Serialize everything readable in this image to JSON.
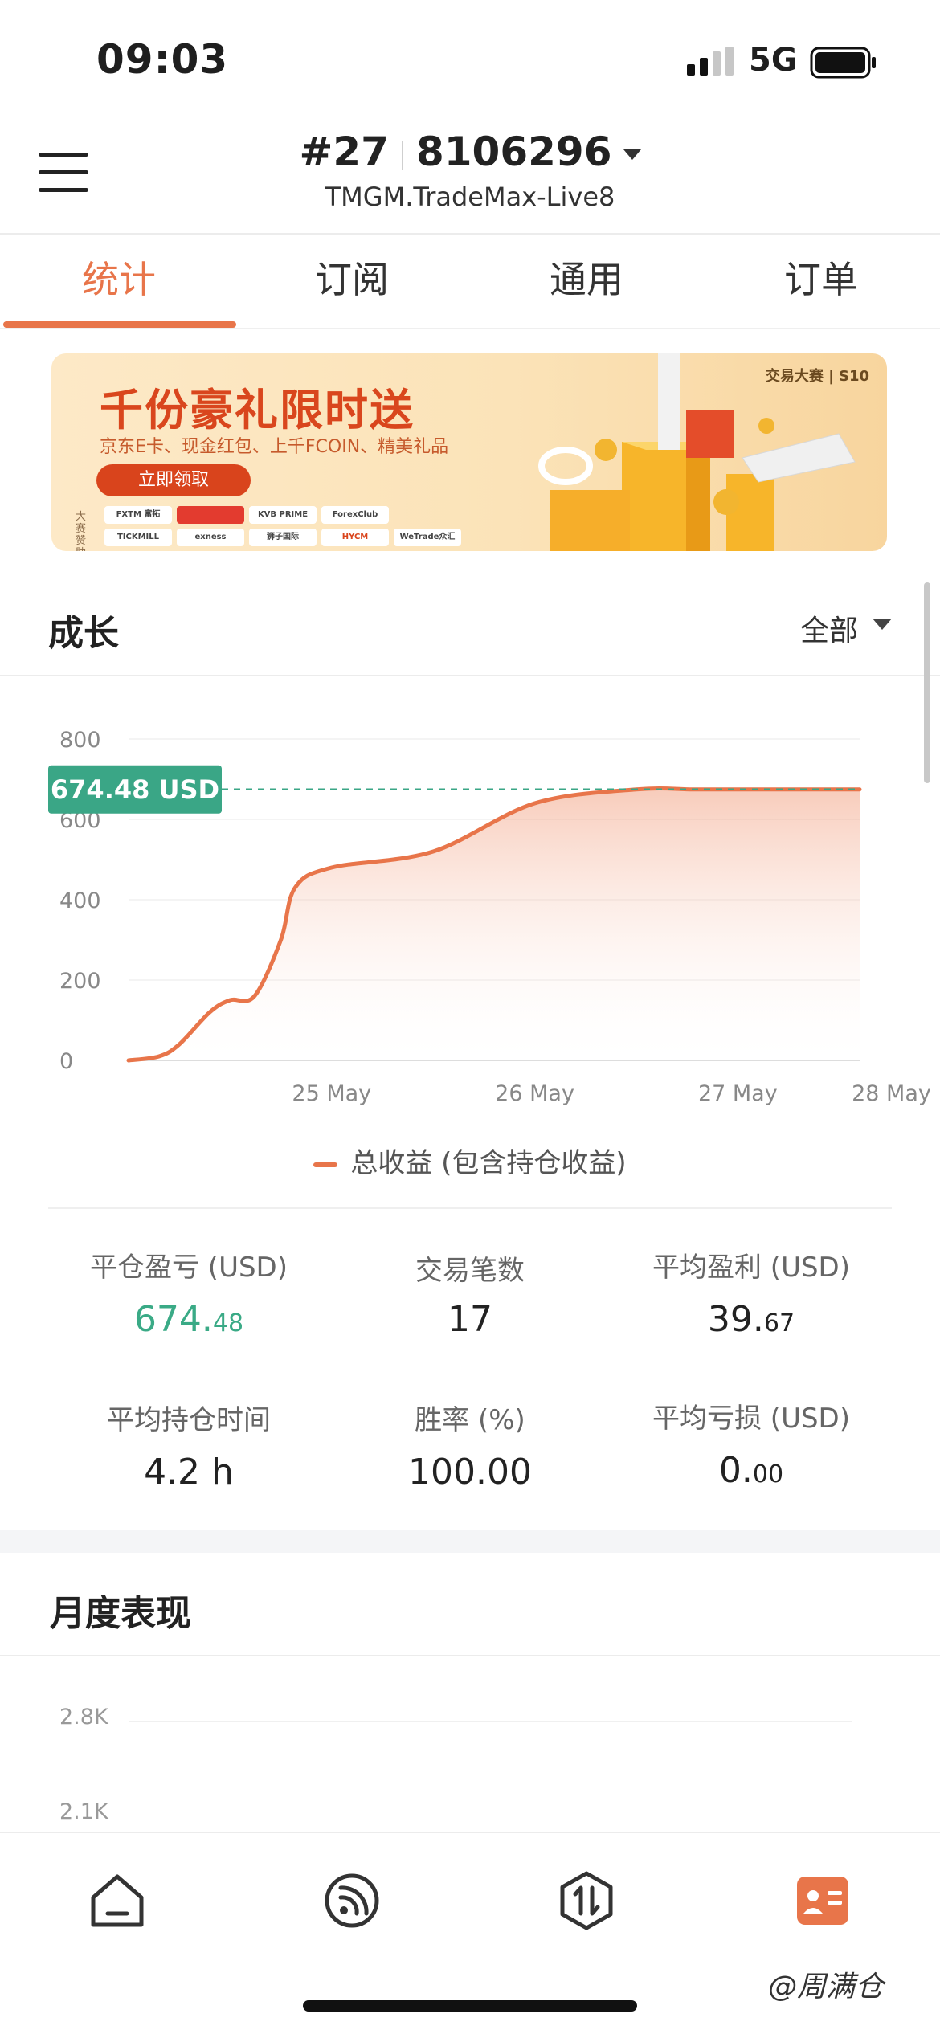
{
  "status_bar": {
    "time": "09:03",
    "network": "5G"
  },
  "header": {
    "account_rank": "#27",
    "account_id": "8106296",
    "server": "TMGM.TradeMax-Live8"
  },
  "tabs": [
    {
      "label": "统计",
      "active": true
    },
    {
      "label": "订阅",
      "active": false
    },
    {
      "label": "通用",
      "active": false
    },
    {
      "label": "订单",
      "active": false
    }
  ],
  "banner": {
    "title": "千份豪礼限时送",
    "subtitle": "京东E卡、现金红包、上千FCOIN、精美礼品",
    "button": "立即领取",
    "sponsor_label": "大赛赞助",
    "brand": "交易大赛 | S10",
    "sponsors": [
      "FXTM 富拓",
      "",
      "KVB PRIME",
      "ForexClub",
      "TICKMILL",
      "exness",
      "狮子国际",
      "HYCM",
      "WeTrade众汇"
    ]
  },
  "growth": {
    "title": "成长",
    "filter": "全部",
    "current_label": "674.48 USD",
    "legend": "总收益 (包含持仓收益)"
  },
  "chart_data": {
    "type": "area",
    "title": "",
    "xlabel": "",
    "ylabel": "",
    "ylim": [
      0,
      800
    ],
    "yticks": [
      "800",
      "600",
      "400",
      "200",
      "0"
    ],
    "xticks": [
      "25 May",
      "26 May",
      "27 May",
      "28 May"
    ],
    "grid": true,
    "series": [
      {
        "name": "总收益 (包含持仓收益)",
        "x": [
          0,
          0.15,
          0.25,
          0.4,
          0.5,
          0.62,
          0.75,
          0.82,
          1.0,
          1.5,
          2.0,
          2.5,
          2.78,
          3.0,
          3.6
        ],
        "y": [
          0,
          10,
          40,
          120,
          150,
          160,
          300,
          430,
          480,
          520,
          640,
          674.48,
          674.48,
          674.48,
          674.48
        ]
      }
    ],
    "reference_line": 674.48,
    "line_color": "#e8754a"
  },
  "stats": [
    {
      "label": "平仓盈亏 (USD)",
      "int": "674.",
      "dec": "48",
      "green": true
    },
    {
      "label": "交易笔数",
      "int": "17",
      "dec": "",
      "green": false
    },
    {
      "label": "平均盈利 (USD)",
      "int": "39.",
      "dec": "67",
      "green": false
    },
    {
      "label": "平均持仓时间",
      "int": "4.2 h",
      "dec": "",
      "green": false
    },
    {
      "label": "胜率 (%)",
      "int": "100.00",
      "dec": "",
      "green": false
    },
    {
      "label": "平均亏损 (USD)",
      "int": "0.",
      "dec": "00",
      "green": false
    }
  ],
  "monthly": {
    "title": "月度表现",
    "yticks": [
      "2.8K",
      "2.1K"
    ]
  },
  "nav": [
    {
      "name": "home-icon"
    },
    {
      "name": "feed-icon"
    },
    {
      "name": "trade-icon"
    },
    {
      "name": "profile-card-icon",
      "active": true
    }
  ],
  "watermark": "@周满仓",
  "colors": {
    "accent": "#e8754a",
    "green": "#3aaa86",
    "label_bg": "#3aa686"
  }
}
